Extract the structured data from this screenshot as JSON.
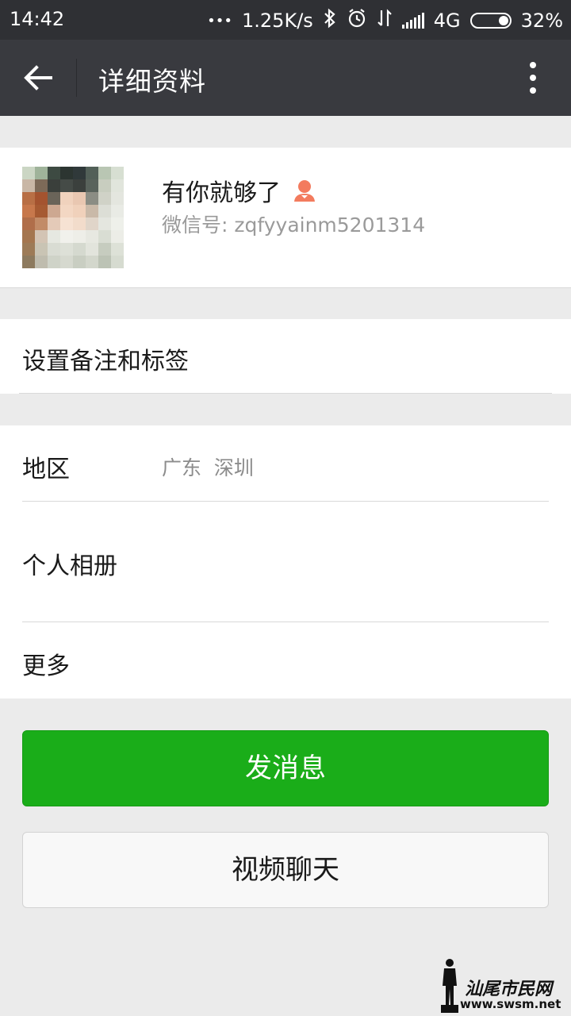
{
  "status_bar": {
    "time": "14:42",
    "dots": "•••",
    "net_speed": "1.25K/s",
    "network": "4G",
    "battery": "32%"
  },
  "nav": {
    "title": "详细资料",
    "back_icon": "arrow-left-icon",
    "more_icon": "more-vertical-icon"
  },
  "profile": {
    "name": "有你就够了",
    "wechat_id": "微信号: zqfyyainm5201314",
    "gender_icon": "female-icon",
    "gender_color": "#f37b5e"
  },
  "remarks": {
    "label": "设置备注和标签"
  },
  "info": {
    "region_label": "地区",
    "region_value": "广东  深圳",
    "album_label": "个人相册",
    "more_label": "更多"
  },
  "actions": {
    "send_message": "发消息",
    "video_call": "视频聊天"
  },
  "colors": {
    "nav_bg": "#393a3f",
    "status_bg": "#2f3034",
    "primary_green": "#1aad19",
    "page_bg": "#ebebeb"
  },
  "watermark": {
    "title": "汕尾市民网",
    "url": "www.swsm.net"
  }
}
